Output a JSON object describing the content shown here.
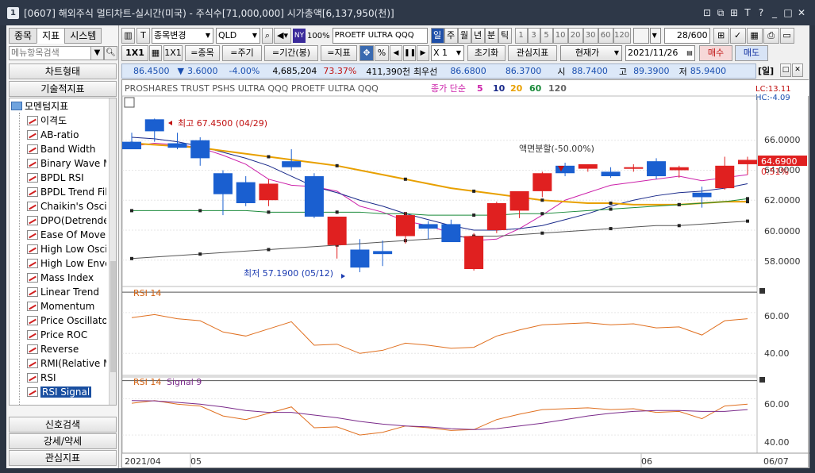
{
  "window": {
    "number": "1",
    "title": "[0607] 해외주식 멀티차트-실시간(미국) - 주식수[71,000,000] 시가총액[6,137,950(천)]",
    "controls": [
      "⊡",
      "⧉",
      "⊞",
      "T",
      "?",
      "_",
      "□",
      "✕"
    ]
  },
  "left": {
    "tabs": [
      "종목",
      "지표",
      "시스템"
    ],
    "search_placeholder": "메뉴항목검색",
    "categories_top": [
      "차트형태",
      "기술적지표"
    ],
    "tree_root": "모멘텀지표",
    "items": [
      "이격도",
      "AB-ratio",
      "Band Width",
      "Binary Wave MACD",
      "BPDL RSI",
      "BPDL Trend Filter",
      "Chaikin's Oscillator",
      "DPO(Detrended Price Osc)",
      "Ease Of Movement",
      "High Low Oscillator",
      "High Low Envelope",
      "Mass Index",
      "Linear Trend",
      "Momentum",
      "Price Oscillator",
      "Price ROC",
      "Reverse",
      "RMI(Relative Momentum Index)",
      "RSI",
      "RSI Signal"
    ],
    "selected_item": "RSI Signal",
    "categories_bottom": [
      "신호검색",
      "강세/약세",
      "관심지표"
    ]
  },
  "toolbar1": {
    "item_change": "종목변경",
    "symbol": "QLD",
    "exchange_badge": "NY",
    "pct": "100%",
    "name": "PROETF ULTRA QQQ",
    "periods": [
      "일",
      "주",
      "월",
      "년",
      "분",
      "틱"
    ],
    "active_period": "일",
    "ticks": [
      "1",
      "3",
      "5",
      "10",
      "20",
      "30",
      "60",
      "120"
    ],
    "count": "28/600"
  },
  "toolbar2": {
    "ratio1": "1X1",
    "ratio2": "1X1",
    "btn_item": "=종목",
    "btn_cycle": "=주기",
    "btn_period": "=기간(봉)",
    "btn_indicator": "=지표",
    "multiplier": "X 1",
    "reset": "초기화",
    "watch": "관심지표",
    "price_mode": "현재가",
    "date": "2021/11/26",
    "buy": "매수",
    "sell": "매도",
    "view": "[일]"
  },
  "quote": {
    "price": "86.4500",
    "change_arrow": "▼",
    "change": "3.6000",
    "change_pct": "-4.00%",
    "volume": "4,685,204",
    "vol_ratio": "73.37%",
    "amount": "411,390천",
    "best_label": "최우선",
    "ask": "86.6800",
    "bid": "86.3700",
    "open_label": "시",
    "open": "88.7400",
    "high_label": "고",
    "high": "89.3900",
    "low_label": "저",
    "low": "85.9400"
  },
  "chart": {
    "header_title": "PROSHARES TRUST PSHS ULTRA QQQ  PROETF ULTRA QQQ",
    "ma_label": "종가 단순",
    "ma_periods": [
      "5",
      "10",
      "20",
      "60",
      "120"
    ],
    "ma_colors": [
      "#cc22aa",
      "#1a2a8a",
      "#e8a000",
      "#1a8a3a",
      "#555555"
    ],
    "lc": "LC:13.11",
    "hc": "HC:-4.09",
    "high_note": "최고 67.4500 (04/29)",
    "low_note": "최저 57.1900 (05/12)",
    "split_note": "액면분할(-50.00%)",
    "last_price": "64.6900",
    "last_pct": "0.51%",
    "price_ticks": [
      "66.0000",
      "64.0000",
      "62.0000",
      "60.0000",
      "58.0000"
    ],
    "rsi_label": "RSI 14",
    "rsi_ticks": [
      "60.00",
      "40.00"
    ],
    "rsi2_label": "RSI 14",
    "rsi2_signal_label": "Signal 9",
    "x_ticks": [
      "2021/04",
      "05",
      "06",
      "06/07"
    ],
    "up_color": "#e02020",
    "down_color": "#1a5fd0"
  },
  "chart_data": {
    "type": "candlestick",
    "ylim": [
      56.5,
      68.0
    ],
    "candles": [
      {
        "o": 65.9,
        "h": 66.5,
        "l": 65.5,
        "c": 65.4
      },
      {
        "o": 67.4,
        "h": 67.45,
        "l": 65.9,
        "c": 66.6
      },
      {
        "o": 65.8,
        "h": 66.5,
        "l": 65.4,
        "c": 65.5
      },
      {
        "o": 66.0,
        "h": 66.2,
        "l": 64.3,
        "c": 64.8
      },
      {
        "o": 63.8,
        "h": 64.0,
        "l": 61.0,
        "c": 62.4
      },
      {
        "o": 63.2,
        "h": 63.6,
        "l": 61.6,
        "c": 61.8
      },
      {
        "o": 62.0,
        "h": 63.4,
        "l": 61.6,
        "c": 63.1
      },
      {
        "o": 64.6,
        "h": 65.4,
        "l": 64.0,
        "c": 64.2
      },
      {
        "o": 63.6,
        "h": 63.8,
        "l": 60.8,
        "c": 60.9
      },
      {
        "o": 59.0,
        "h": 60.8,
        "l": 58.1,
        "c": 60.9
      },
      {
        "o": 58.7,
        "h": 59.4,
        "l": 57.19,
        "c": 57.5
      },
      {
        "o": 58.6,
        "h": 59.3,
        "l": 57.6,
        "c": 58.4
      },
      {
        "o": 59.6,
        "h": 61.2,
        "l": 59.1,
        "c": 61.0
      },
      {
        "o": 60.4,
        "h": 60.6,
        "l": 59.4,
        "c": 60.1
      },
      {
        "o": 60.4,
        "h": 60.7,
        "l": 59.3,
        "c": 59.2
      },
      {
        "o": 57.4,
        "h": 59.8,
        "l": 57.3,
        "c": 59.6
      },
      {
        "o": 60.0,
        "h": 61.9,
        "l": 59.8,
        "c": 61.8
      },
      {
        "o": 61.3,
        "h": 62.5,
        "l": 60.8,
        "c": 62.6
      },
      {
        "o": 62.6,
        "h": 63.9,
        "l": 62.2,
        "c": 63.8
      },
      {
        "o": 64.3,
        "h": 64.5,
        "l": 63.6,
        "c": 63.8
      },
      {
        "o": 64.1,
        "h": 64.4,
        "l": 63.9,
        "c": 64.4
      },
      {
        "o": 63.9,
        "h": 64.2,
        "l": 63.5,
        "c": 63.6
      },
      {
        "o": 64.1,
        "h": 64.4,
        "l": 63.9,
        "c": 64.2
      },
      {
        "o": 64.6,
        "h": 64.8,
        "l": 63.4,
        "c": 63.6
      },
      {
        "o": 64.0,
        "h": 64.3,
        "l": 63.5,
        "c": 64.2
      },
      {
        "o": 62.5,
        "h": 62.9,
        "l": 61.5,
        "c": 62.2
      },
      {
        "o": 62.8,
        "h": 64.9,
        "l": 62.7,
        "c": 64.3
      },
      {
        "o": 64.4,
        "h": 64.9,
        "l": 63.7,
        "c": 64.69
      }
    ],
    "ma5": [
      65.6,
      65.8,
      65.7,
      65.5,
      65.0,
      64.4,
      63.4,
      63.0,
      62.9,
      62.6,
      61.6,
      61.2,
      60.6,
      60.3,
      59.8,
      59.3,
      59.4,
      60.1,
      61.0,
      62.0,
      62.5,
      63.0,
      63.2,
      63.4,
      63.6,
      63.3,
      63.5,
      63.7
    ],
    "ma10": [
      66.2,
      66.1,
      65.9,
      65.6,
      65.2,
      64.8,
      64.3,
      63.6,
      62.9,
      62.5,
      62.0,
      61.6,
      61.1,
      60.7,
      60.3,
      60.0,
      60.0,
      60.1,
      60.3,
      60.7,
      61.1,
      61.6,
      62.0,
      62.3,
      62.5,
      62.6,
      62.8,
      63.1
    ],
    "ma20": [
      65.8,
      65.7,
      65.6,
      65.5,
      65.3,
      65.1,
      64.9,
      64.7,
      64.5,
      64.3,
      64.0,
      63.7,
      63.4,
      63.1,
      62.8,
      62.6,
      62.4,
      62.2,
      62.0,
      61.9,
      61.8,
      61.8,
      61.7,
      61.7,
      61.7,
      61.8,
      61.9,
      61.9
    ],
    "ma60": [
      61.3,
      61.3,
      61.3,
      61.3,
      61.3,
      61.3,
      61.2,
      61.2,
      61.2,
      61.2,
      61.2,
      61.1,
      61.1,
      61.0,
      61.0,
      61.0,
      61.0,
      61.1,
      61.1,
      61.2,
      61.3,
      61.4,
      61.5,
      61.6,
      61.7,
      61.8,
      61.9,
      62.1
    ],
    "ma120": [
      58.1,
      58.2,
      58.3,
      58.4,
      58.5,
      58.6,
      58.7,
      58.8,
      58.9,
      59.0,
      59.1,
      59.2,
      59.3,
      59.4,
      59.5,
      59.6,
      59.6,
      59.7,
      59.8,
      59.9,
      60.0,
      60.1,
      60.2,
      60.3,
      60.3,
      60.4,
      60.5,
      60.6
    ],
    "rsi_ylim": [
      30,
      72
    ],
    "rsi": [
      57.5,
      59.0,
      57.0,
      56.0,
      50.5,
      48.5,
      52.0,
      55.5,
      44.0,
      44.5,
      40.0,
      41.5,
      45.0,
      44.0,
      42.5,
      43.0,
      48.5,
      51.5,
      54.0,
      54.5,
      55.0,
      54.0,
      54.5,
      52.5,
      53.0,
      49.0,
      56.0,
      57.0
    ],
    "rsi_signal": [
      59.0,
      58.8,
      58.0,
      57.0,
      55.5,
      53.5,
      52.5,
      52.5,
      51.0,
      49.5,
      47.5,
      46.0,
      45.0,
      44.5,
      43.5,
      43.0,
      43.5,
      45.0,
      46.5,
      48.5,
      50.5,
      52.0,
      53.0,
      53.5,
      53.5,
      53.0,
      53.0,
      54.0
    ]
  }
}
